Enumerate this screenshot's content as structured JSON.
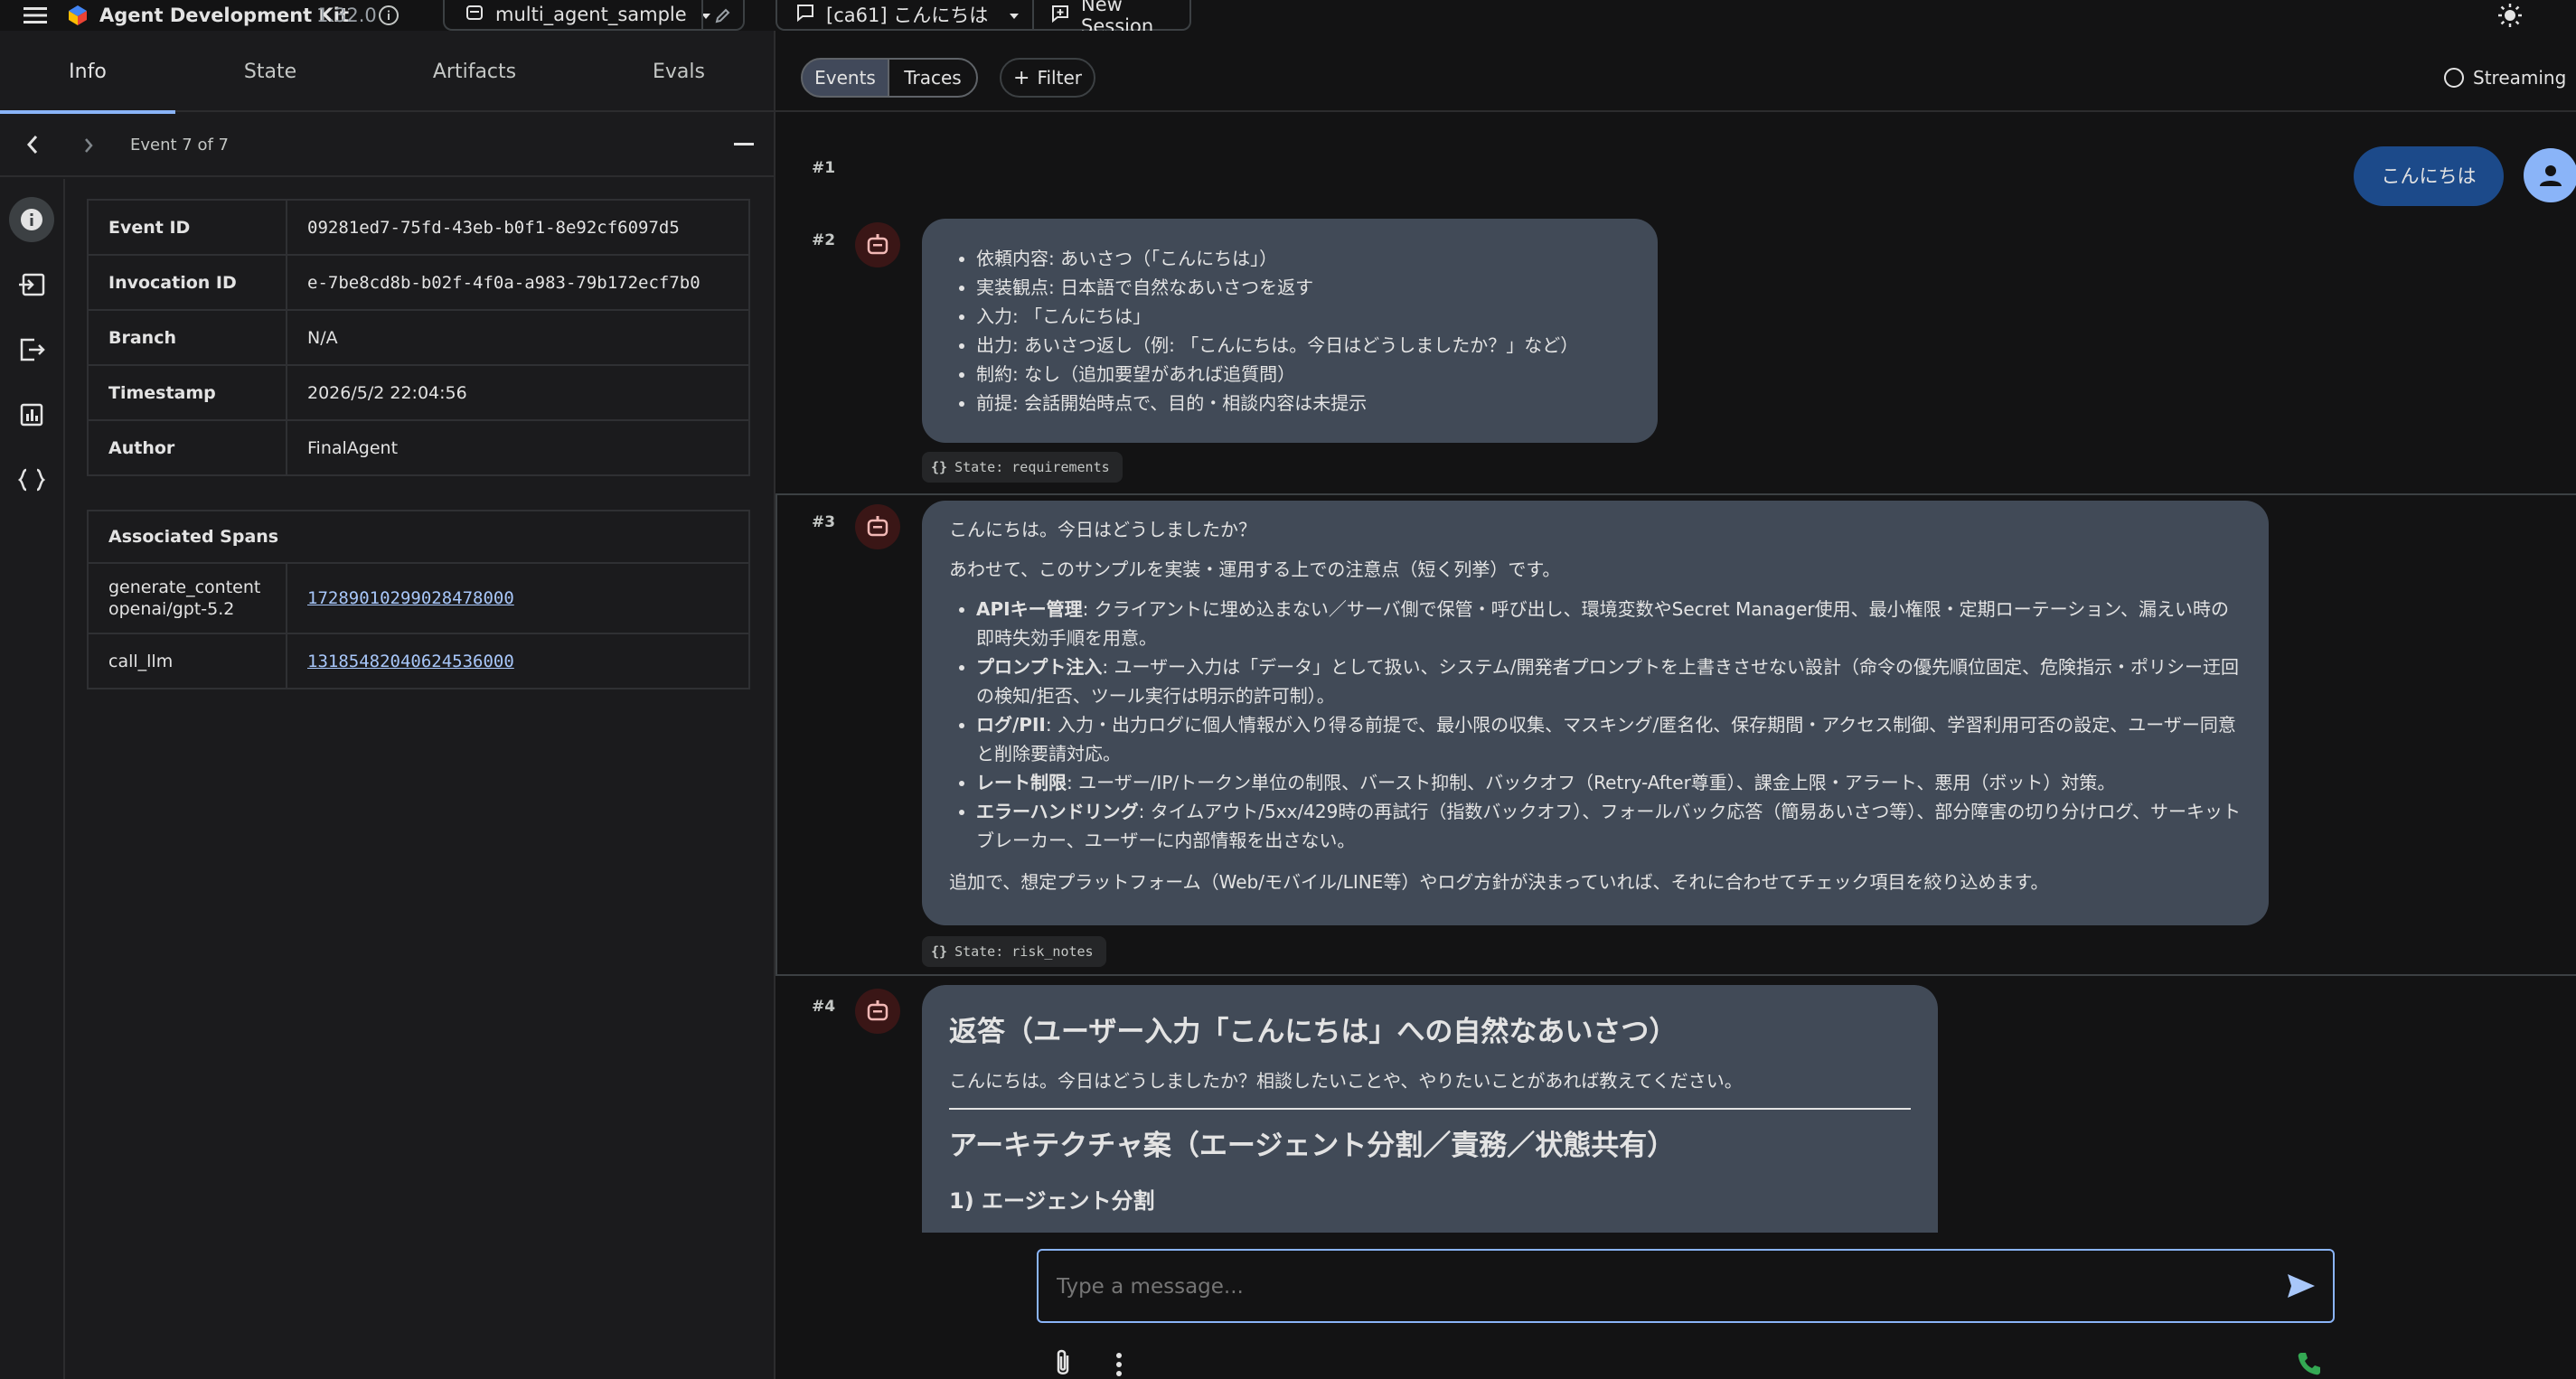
{
  "app": {
    "title": "Agent Development Kit",
    "version": "1.32.0",
    "agent": "multi_agent_sample",
    "session": "[ca61] こんにちは",
    "new_session": "New Session"
  },
  "left": {
    "tabs": [
      "Info",
      "State",
      "Artifacts",
      "Evals"
    ],
    "event_label": "Event 7 of 7",
    "details": [
      {
        "key": "Event ID",
        "value": "09281ed7-75fd-43eb-b0f1-8e92cf6097d5"
      },
      {
        "key": "Invocation ID",
        "value": "e-7be8cd8b-b02f-4f0a-a983-79b172ecf7b0"
      },
      {
        "key": "Branch",
        "value": "N/A"
      },
      {
        "key": "Timestamp",
        "value": "2026/5/2 22:04:56"
      },
      {
        "key": "Author",
        "value": "FinalAgent"
      }
    ],
    "spans_header": "Associated Spans",
    "spans": [
      {
        "name": "generate_content openai/gpt-5.2",
        "id": "17289010299028478000"
      },
      {
        "name": "call_llm",
        "id": "13185482040624536000"
      }
    ]
  },
  "right": {
    "toggle": [
      "Events",
      "Traces"
    ],
    "filter": "Filter",
    "streaming": "Streaming",
    "events": {
      "e1": {
        "num": "#1",
        "user_text": "こんにちは"
      },
      "e2": {
        "num": "#2",
        "items": [
          "依頼内容: あいさつ（「こんにちは」）",
          "実装観点: 日本語で自然なあいさつを返す",
          "入力: 「こんにちは」",
          "出力: あいさつ返し（例: 「こんにちは。今日はどうしましたか？」など）",
          "制約: なし（追加要望があれば追質問）",
          "前提: 会話開始時点で、目的・相談内容は未提示"
        ],
        "chip": "State: requirements"
      },
      "e3": {
        "num": "#3",
        "p1": "こんにちは。今日はどうしましたか？",
        "p2": "あわせて、このサンプルを実装・運用する上での注意点（短く列挙）です。",
        "items": [
          {
            "b": "APIキー管理",
            "t": ": クライアントに埋め込まない／サーバ側で保管・呼び出し、環境変数やSecret Manager使用、最小権限・定期ローテーション、漏えい時の即時失効手順を用意。"
          },
          {
            "b": "プロンプト注入",
            "t": ": ユーザー入力は「データ」として扱い、システム/開発者プロンプトを上書きさせない設計（命令の優先順位固定、危険指示・ポリシー迂回の検知/拒否、ツール実行は明示的許可制）。"
          },
          {
            "b": "ログ/PII",
            "t": ": 入力・出力ログに個人情報が入り得る前提で、最小限の収集、マスキング/匿名化、保存期間・アクセス制御、学習利用可否の設定、ユーザー同意と削除要請対応。"
          },
          {
            "b": "レート制限",
            "t": ": ユーザー/IP/トークン単位の制限、バースト抑制、バックオフ（Retry-After尊重）、課金上限・アラート、悪用（ボット）対策。"
          },
          {
            "b": "エラーハンドリング",
            "t": ": タイムアウト/5xx/429時の再試行（指数バックオフ）、フォールバック応答（簡易あいさつ等）、部分障害の切り分けログ、サーキットブレーカー、ユーザーに内部情報を出さない。"
          }
        ],
        "p3": "追加で、想定プラットフォーム（Web/モバイル/LINE等）やログ方針が決まっていれば、それに合わせてチェック項目を絞り込めます。",
        "chip": "State: risk_notes"
      },
      "e4": {
        "num": "#4",
        "h1": "返答（ユーザー入力「こんにちは」への自然なあいさつ）",
        "p1": "こんにちは。今日はどうしましたか？相談したいことや、やりたいことがあれば教えてください。",
        "h2": "アーキテクチャ案（エージェント分割／責務／状態共有）",
        "h3": "1) エージェント分割"
      }
    },
    "composer_placeholder": "Type a message..."
  },
  "colors": {
    "accent": "#8ab4f8",
    "user_bubble": "#1c4a8a",
    "bot_bubble": "#414a57",
    "avatar_bg": "#3a1616"
  }
}
